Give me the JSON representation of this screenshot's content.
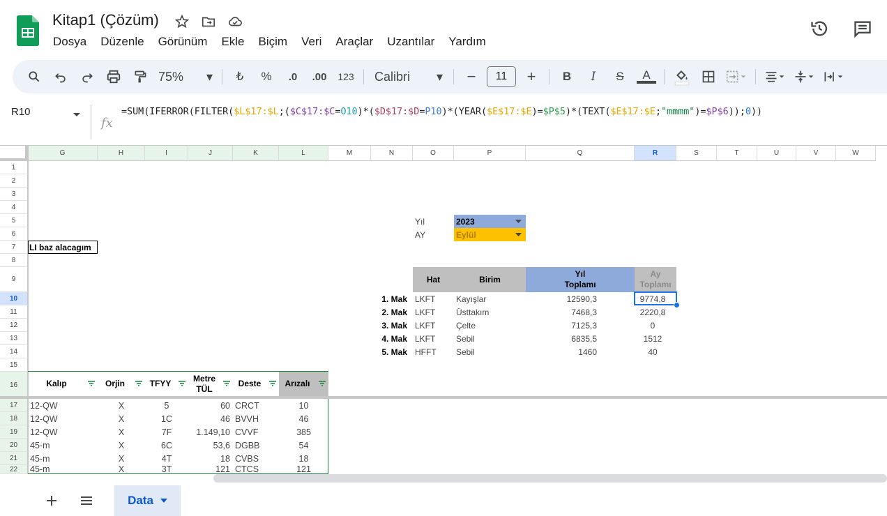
{
  "header": {
    "title": "Kitap1 (Çözüm)",
    "menu": [
      "Dosya",
      "Düzenle",
      "Görünüm",
      "Ekle",
      "Biçim",
      "Veri",
      "Araçlar",
      "Uzantılar",
      "Yardım"
    ]
  },
  "toolbar": {
    "zoom": "75%",
    "currency": "₺",
    "percent": "%",
    "dec_decrease": ".0",
    "dec_increase": ".00",
    "number_format": "123",
    "font": "Calibri",
    "font_size": "11",
    "bold": "B",
    "italic": "I",
    "strike": "S",
    "text_color": "A"
  },
  "formula_bar": {
    "cell_ref": "R10",
    "fx": "fx",
    "formula_parts": [
      {
        "t": "=SUM(IFERROR(FILTER(",
        "c": "#1f1f1f"
      },
      {
        "t": "$L$17:$L",
        "c": "#e6a700"
      },
      {
        "t": ";(",
        "c": "#1f1f1f"
      },
      {
        "t": "$C$17:$C",
        "c": "#7e3fa6"
      },
      {
        "t": "=",
        "c": "#1f1f1f"
      },
      {
        "t": "O10",
        "c": "#1a9fb5"
      },
      {
        "t": ")*(",
        "c": "#1f1f1f"
      },
      {
        "t": "$D$17:$D",
        "c": "#a83d5b"
      },
      {
        "t": "=",
        "c": "#1f1f1f"
      },
      {
        "t": "P10",
        "c": "#3c78d8"
      },
      {
        "t": ")*(YEAR(",
        "c": "#1f1f1f"
      },
      {
        "t": "$E$17:$E",
        "c": "#e6a700"
      },
      {
        "t": ")=",
        "c": "#1f1f1f"
      },
      {
        "t": "$P$5",
        "c": "#2e9a4e"
      },
      {
        "t": ")*(TEXT(",
        "c": "#1f1f1f"
      },
      {
        "t": "$E$17:$E",
        "c": "#e6a700"
      },
      {
        "t": ";",
        "c": "#1f1f1f"
      },
      {
        "t": "\"mmmm\"",
        "c": "#0b8043"
      },
      {
        "t": ")=",
        "c": "#1f1f1f"
      },
      {
        "t": "$P$6",
        "c": "#7e3fa6"
      },
      {
        "t": "));",
        "c": "#1f1f1f"
      },
      {
        "t": "0",
        "c": "#1a73e8"
      },
      {
        "t": "))",
        "c": "#1f1f1f"
      }
    ]
  },
  "columns": [
    "G",
    "H",
    "I",
    "J",
    "K",
    "L",
    "M",
    "N",
    "O",
    "P",
    "Q",
    "R",
    "S",
    "T",
    "U",
    "V",
    "W"
  ],
  "rows": [
    "1",
    "2",
    "3",
    "4",
    "5",
    "6",
    "7",
    "8",
    "9",
    "10",
    "11",
    "12",
    "13",
    "14",
    "15",
    "16",
    "17",
    "18",
    "19",
    "20",
    "21",
    "22"
  ],
  "cells": {
    "year_label": "Yıl",
    "month_label": "AY",
    "year_value": "2023",
    "month_value": "Eylül",
    "note": "LI baz alacagım"
  },
  "summary": {
    "headers": [
      "Hat",
      "Birim",
      "Yıl\nToplamı",
      "Ay\nToplamı"
    ],
    "rows": [
      {
        "label": "1. Mak",
        "hat": "LKFT",
        "birim": "Kayışlar",
        "yil": "12590,3",
        "ay": "9774,8"
      },
      {
        "label": "2. Mak",
        "hat": "LKFT",
        "birim": "Üsttakım",
        "yil": "7468,3",
        "ay": "2220,8"
      },
      {
        "label": "3. Mak",
        "hat": "LKFT",
        "birim": "Çelte",
        "yil": "7125,3",
        "ay": "0"
      },
      {
        "label": "4. Mak",
        "hat": "LKFT",
        "birim": "Sebil",
        "yil": "6835,5",
        "ay": "1512"
      },
      {
        "label": "5. Mak",
        "hat": "HFFT",
        "birim": "Sebil",
        "yil": "1460",
        "ay": "40"
      }
    ]
  },
  "data_table": {
    "headers": [
      "Kalıp",
      "Orjin",
      "TFYY",
      "Metre\nTÜL",
      "Deste",
      "Arızalı"
    ],
    "rows": [
      [
        "12-QW",
        "X",
        "5",
        "60",
        "CRCT",
        "10"
      ],
      [
        "12-QW",
        "X",
        "1C",
        "46",
        "BVVH",
        "46"
      ],
      [
        "12-QW",
        "X",
        "7F",
        "1.149,10",
        "CVVF",
        "385"
      ],
      [
        "45-m",
        "X",
        "6C",
        "53,6",
        "DGBB",
        "54"
      ],
      [
        "45-m",
        "X",
        "4T",
        "18",
        "CVBS",
        "18"
      ],
      [
        "45-m",
        "X",
        "3T",
        "121",
        "CTCS",
        "121"
      ]
    ]
  },
  "sheets": {
    "active": "Data"
  },
  "colors": {
    "year_bg": "#8eaadb",
    "month_bg": "#ffc000",
    "header_gray": "#bfbfbf",
    "header_blue": "#8eaadb",
    "selection": "#1a73e8"
  }
}
